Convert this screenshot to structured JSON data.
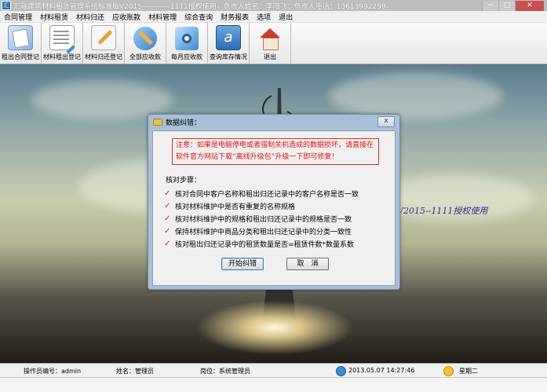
{
  "window": {
    "title": "汇融建筑材料租赁管理系统标准版V2015-----------1111授权使用，负责人姓名：李阳飞；负责人电话：13613992299。",
    "controls": [
      "─",
      "□",
      "✕"
    ]
  },
  "menu": [
    "合同管理",
    "材料租赁",
    "材料归还",
    "应收账款",
    "材料管理",
    "综合查询",
    "财务报表",
    "选项",
    "退出"
  ],
  "toolbar": [
    {
      "label": "租出合同登记",
      "icon": "contract-book-icon"
    },
    {
      "label": "材料租出登记",
      "icon": "rental-sheet-icon"
    },
    {
      "label": "材料归还登记",
      "icon": "return-pen-icon"
    },
    {
      "label": "全部应收款",
      "icon": "receivables-tools-icon"
    },
    {
      "label": "每月应收款",
      "icon": "monthly-gear-icon"
    },
    {
      "label": "查询库存情况",
      "icon": "inventory-a-icon"
    },
    {
      "label": "退出",
      "icon": "home-exit-icon"
    }
  ],
  "watermark": "V2015--1111授权使用",
  "dialog": {
    "title": "数据纠错：",
    "close_label": "x",
    "warning": "注意：如果是电脑停电或者强制关机造成的数据损坏，请直接在软件官方网站下载“离线升级包”升级一下即可修复！",
    "steps_title": "核对步骤：",
    "steps": [
      "核对合同中客户名称和租出归还记录中的客户名称是否一致",
      "核对材料维护中是否有重复的名称规格",
      "核对材料维护中的规格和租出归还记录中的规格是否一致",
      "保持材料维护中商品分类和租出归还记录中的分类一致性",
      "核对租出归还记录中的租赁数量是否=租赁件数*数量系数"
    ],
    "start_button": "开始纠错",
    "cancel_button": "取　消"
  },
  "status": {
    "operator_label": "操作员编号：admin",
    "name_label": "姓名：管理员",
    "post_label": "岗位：系统管理员",
    "datetime": "2013.05.07 14:27:46",
    "weekday": "星期二"
  },
  "colors": {
    "warning_red": "#e01010",
    "dialog_frame": "#a9bfd6",
    "watermark": "#3a2f8a"
  }
}
